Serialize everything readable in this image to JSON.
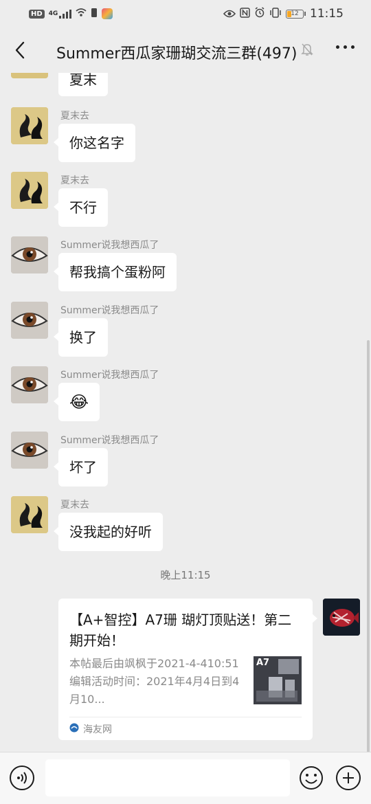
{
  "status_bar": {
    "hd": "HD",
    "network": "4G",
    "time": "11:15",
    "battery": "12"
  },
  "header": {
    "title": "Summer西瓜家珊瑚交流三群(497)"
  },
  "messages": [
    {
      "sender": "",
      "text": "夏末"
    },
    {
      "sender": "夏末去",
      "text": "你这名字"
    },
    {
      "sender": "夏末去",
      "text": "不行"
    },
    {
      "sender": "Summer说我想西瓜了",
      "text": "帮我搞个蛋粉阿"
    },
    {
      "sender": "Summer说我想西瓜了",
      "text": "换了"
    },
    {
      "sender": "Summer说我想西瓜了",
      "text": "😂"
    },
    {
      "sender": "Summer说我想西瓜了",
      "text": "坏了"
    },
    {
      "sender": "夏末去",
      "text": "没我起的好听"
    }
  ],
  "timestamp": "晚上11:15",
  "link_card": {
    "title": "【A+智控】A7珊 瑚灯顶贴送！第二期开始！",
    "description": "本帖最后由飒枫于2021-4-410:51编辑活动时间：2021年4月4日到4月10...",
    "thumb_label": "A7",
    "source": "海友网"
  },
  "input": {
    "placeholder": ""
  }
}
